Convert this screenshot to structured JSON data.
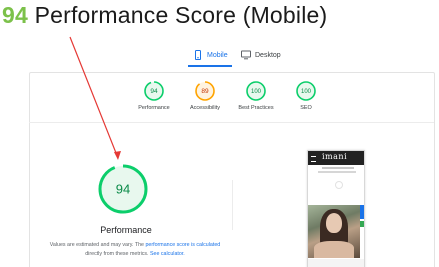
{
  "headline": {
    "score": "94",
    "title": "Performance Score (Mobile)"
  },
  "tabs": {
    "mobile": "Mobile",
    "desktop": "Desktop"
  },
  "scores": [
    {
      "value": "94",
      "label": "Performance",
      "color": "#0cce6b",
      "fill": "#e8f8ee",
      "fraction": 0.94
    },
    {
      "value": "89",
      "label": "Accessibility",
      "color": "#ffa400",
      "fill": "#fff3e0",
      "fraction": 0.89
    },
    {
      "value": "100",
      "label": "Best Practices",
      "color": "#0cce6b",
      "fill": "#e8f8ee",
      "fraction": 1.0
    },
    {
      "value": "100",
      "label": "SEO",
      "color": "#0cce6b",
      "fill": "#e8f8ee",
      "fraction": 1.0
    }
  ],
  "main": {
    "value": "94",
    "label": "Performance",
    "color": "#0cce6b",
    "fraction": 0.94,
    "note_start": "Values are estimated and may vary. The",
    "note_link1": "performance score is calculated",
    "note_mid": "directly from these metrics.",
    "note_link2": "See calculator."
  },
  "phone": {
    "brand": "imani"
  },
  "colors": {
    "annotation": "#e53935",
    "accent": "#1a73e8"
  }
}
